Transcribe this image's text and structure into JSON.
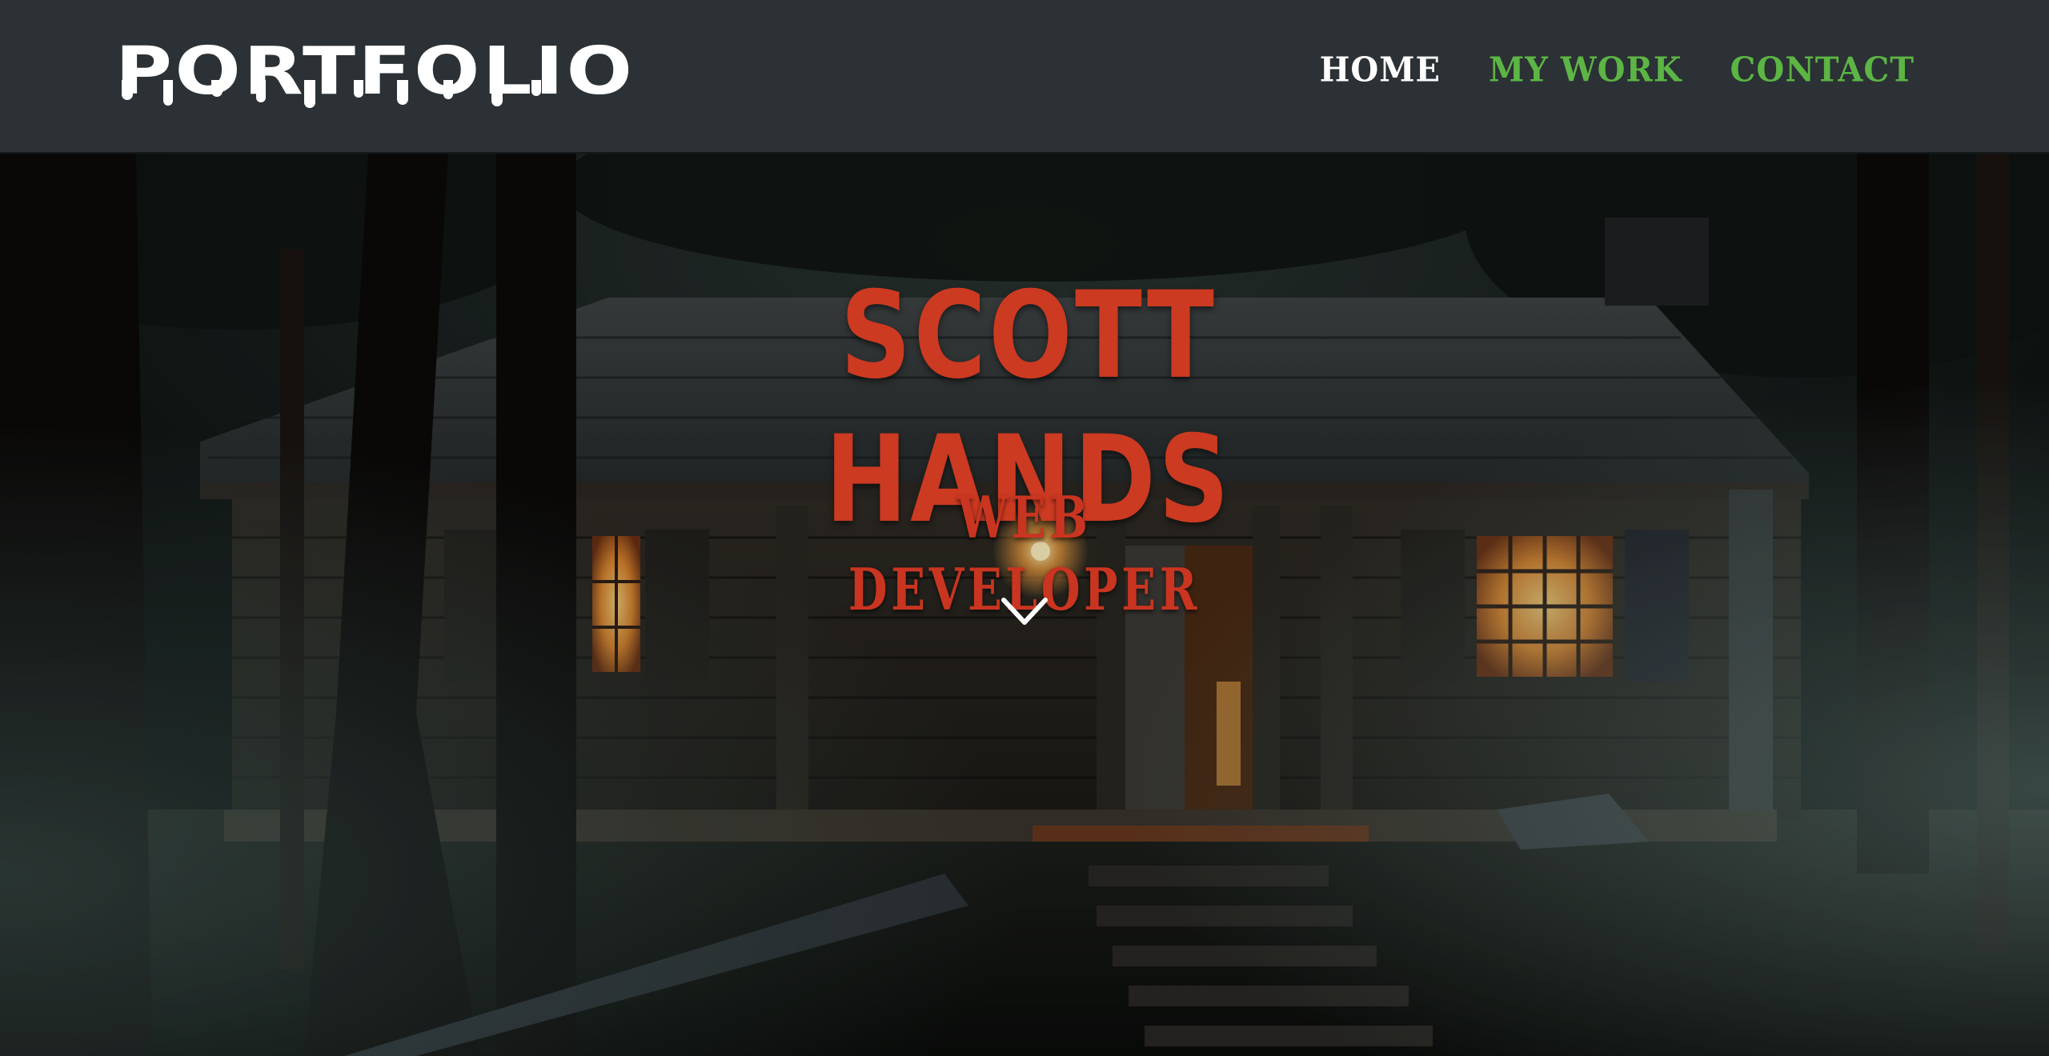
{
  "brand": {
    "label": "PORTFOLIO"
  },
  "nav": {
    "items": [
      {
        "label": "HOME",
        "active": true
      },
      {
        "label": "MY WORK",
        "active": false
      },
      {
        "label": "CONTACT",
        "active": false
      }
    ]
  },
  "hero": {
    "title": "SCOTT HANDS",
    "subtitle": "WEB DEVELOPER",
    "scroll_icon": "chevron-down-icon"
  },
  "colors": {
    "navbar_bg": "#2b3135",
    "brand_text": "#ffffff",
    "nav_active": "#ffffff",
    "nav_link": "#5cb544",
    "hero_text": "#cc3a21"
  }
}
